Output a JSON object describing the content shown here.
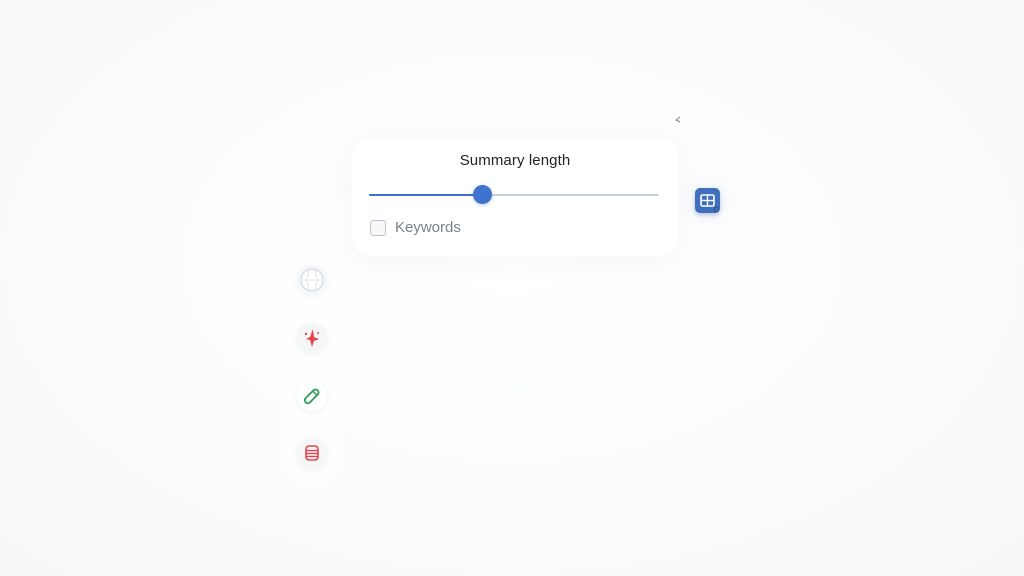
{
  "summary": {
    "title": "Summary length",
    "slider_value_percent": 39,
    "keywords_label": "Keywords",
    "keywords_checked": false
  },
  "colors": {
    "accent": "#3f72cf",
    "track": "#c9d2dc",
    "table_button": "#3f6fbd",
    "tool_red": "#e0474c",
    "tool_green": "#2f9a5a"
  },
  "icons": {
    "table_button": "table-search-icon",
    "tools": [
      "globe-icon",
      "magic-sparkle-icon",
      "pencil-icon",
      "database-icon"
    ]
  }
}
